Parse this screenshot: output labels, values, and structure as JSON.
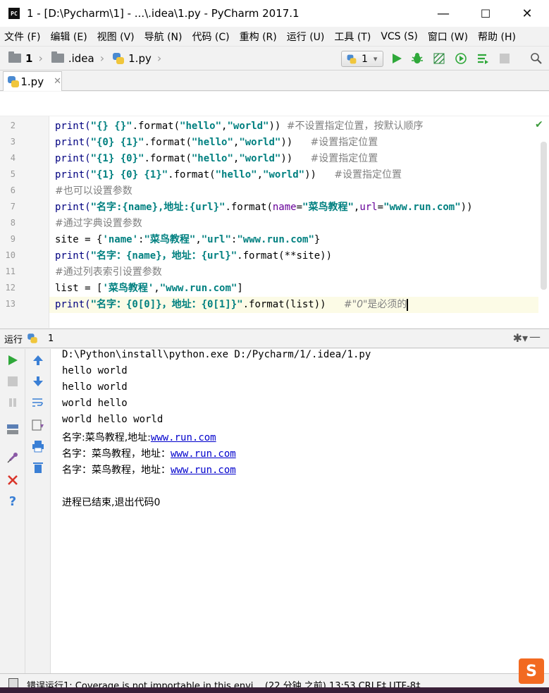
{
  "window": {
    "title": "1 - [D:\\Pycharm\\1] - ...\\.idea\\1.py - PyCharm 2017.1",
    "app_icon": "PC",
    "minimize": "—",
    "maximize": "☐",
    "close": "✕"
  },
  "menu": [
    "文件 (F)",
    "编辑 (E)",
    "视图 (V)",
    "导航 (N)",
    "代码 (C)",
    "重构 (R)",
    "运行 (U)",
    "工具 (T)",
    "VCS (S)",
    "窗口 (W)",
    "帮助 (H)"
  ],
  "nav": {
    "breadcrumb": [
      "1",
      ".idea",
      "1.py"
    ],
    "run_config": "1",
    "run_config_arrow": "▾"
  },
  "toolbar_icons": [
    "run-icon",
    "debug-icon",
    "coverage-icon",
    "profile-icon",
    "concurrency-icon",
    "stop-icon",
    "search-icon"
  ],
  "tab": {
    "label": "1.py",
    "close": "✕"
  },
  "editor": {
    "lines": [
      {
        "num": "2"
      },
      {
        "num": "3"
      },
      {
        "num": "4"
      },
      {
        "num": "5"
      },
      {
        "num": "6"
      },
      {
        "num": "7"
      },
      {
        "num": "8"
      },
      {
        "num": "9"
      },
      {
        "num": "10"
      },
      {
        "num": "11"
      },
      {
        "num": "12"
      },
      {
        "num": "13"
      }
    ],
    "code": {
      "l2": {
        "a": "print(",
        "s": "\"{} {}\"",
        "b": ".format(",
        "s2": "\"hello\"",
        "c": ",",
        "s3": "\"world\"",
        "d": ")) ",
        "cm": "#不设置指定位置，按默认顺序"
      },
      "l3": {
        "a": "print(",
        "s": "\"{0} {1}\"",
        "b": ".format(",
        "s2": "\"hello\"",
        "c": ",",
        "s3": "\"world\"",
        "d": "))   ",
        "cm": "#设置指定位置"
      },
      "l4": {
        "a": "print(",
        "s": "\"{1} {0}\"",
        "b": ".format(",
        "s2": "\"hello\"",
        "c": ",",
        "s3": "\"world\"",
        "d": "))   ",
        "cm": "#设置指定位置"
      },
      "l5": {
        "a": "print(",
        "s": "\"{1} {0} {1}\"",
        "b": ".format(",
        "s2": "\"hello\"",
        "c": ",",
        "s3": "\"world\"",
        "d": "))   ",
        "cm": "#设置指定位置"
      },
      "l6": {
        "cm": "#也可以设置参数"
      },
      "l7": {
        "a": "print(",
        "s": "\"名字:{name},地址:{url}\"",
        "b": ".format(",
        "p1": "name",
        "e": "=",
        "s2": "\"菜鸟教程\"",
        "c": ",",
        "p2": "url",
        "e2": "=",
        "s3": "\"www.run.com\"",
        "d": "))"
      },
      "l8": {
        "cm": "#通过字典设置参数"
      },
      "l9": {
        "a": "site = {",
        "s": "'name'",
        "c": ":",
        "s2": "\"菜鸟教程\"",
        "c2": ",",
        "s3": "\"url\"",
        "c3": ":",
        "s4": "\"www.run.com\"",
        "d": "}"
      },
      "l10": {
        "a": "print(",
        "s": "\"名字：{name}，地址：{url}\"",
        "b": ".format(**site))"
      },
      "l11": {
        "cm": "#通过列表索引设置参数"
      },
      "l12": {
        "a": "list = [",
        "s": "'菜鸟教程'",
        "c": ",",
        "s2": "\"www.run.com\"",
        "d": "]"
      },
      "l13": {
        "a": "print(",
        "s": "\"名字：{0[0]}，地址：{0[1]}\"",
        "b": ".format(list))   ",
        "cm1": "#",
        "cm2": "\"0\"",
        "cm3": "是必须的"
      }
    },
    "check": "✔"
  },
  "run_panel": {
    "label": "运行",
    "config": "1",
    "gear": "✱▾",
    "hide": "—"
  },
  "console": {
    "cmd": "D:\\Python\\install\\python.exe D:/Pycharm/1/.idea/1.py",
    "out1": "hello world",
    "out2": "hello world",
    "out3": "world hello",
    "out4": "world hello world",
    "out5_prefix": "名字:菜鸟教程,地址:",
    "out6_prefix": "名字：菜鸟教程，地址：",
    "out7_prefix": "名字：菜鸟教程，地址：",
    "link": "www.run.com",
    "exit": "进程已结束,退出代码0"
  },
  "status": {
    "text": "错误运行1: Coverage is not importable in this envi... (22 分钟 之前)    13:53   CRLF‡   UTF-8‡"
  },
  "watermark": {
    "logo": "S"
  },
  "colors": {
    "string": "#008080",
    "keyword": "#000080",
    "comment": "#808080",
    "param": "#660099",
    "run_green": "#2fa83a",
    "stop_red": "#d9352b",
    "current_line": "#fcfbe6"
  }
}
